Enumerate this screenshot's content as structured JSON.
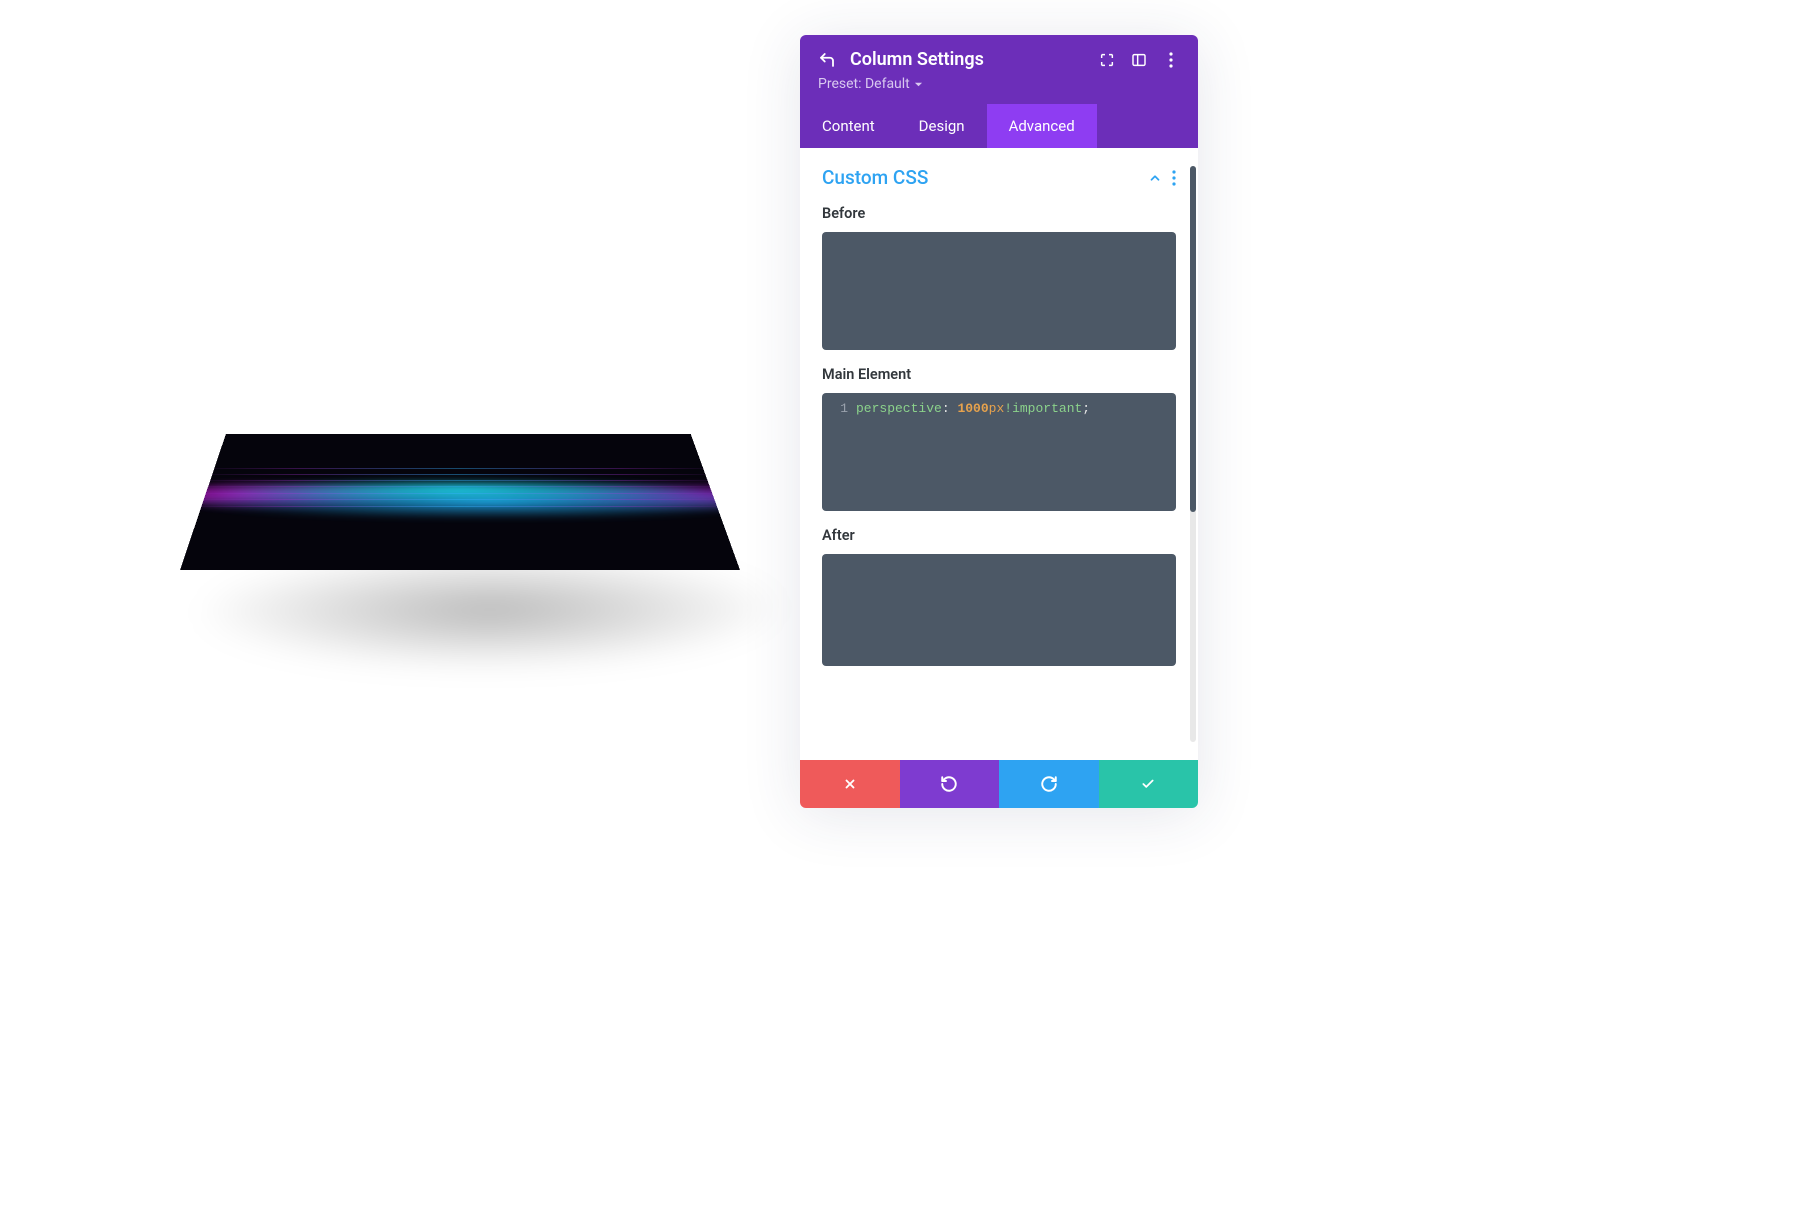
{
  "panel": {
    "title": "Column Settings",
    "preset_label": "Preset: Default"
  },
  "tabs": {
    "content": "Content",
    "design": "Design",
    "advanced": "Advanced",
    "active": "advanced"
  },
  "section": {
    "title": "Custom CSS"
  },
  "fields": {
    "before_label": "Before",
    "main_label": "Main Element",
    "after_label": "After"
  },
  "code": {
    "main_line_no": "1",
    "main_prop": "perspective",
    "main_colon": ":",
    "main_value_num": "1000",
    "main_value_unit": "px",
    "main_important": "!important",
    "main_semi": ";"
  },
  "colors": {
    "header": "#6c2eb9",
    "tab_active": "#8e3df2",
    "accent_blue": "#2ea3f2",
    "code_bg": "#4c5866",
    "footer_cancel": "#ef5a5a",
    "footer_undo": "#7e3bd0",
    "footer_redo": "#2ea3f2",
    "footer_save": "#29c4a9"
  }
}
